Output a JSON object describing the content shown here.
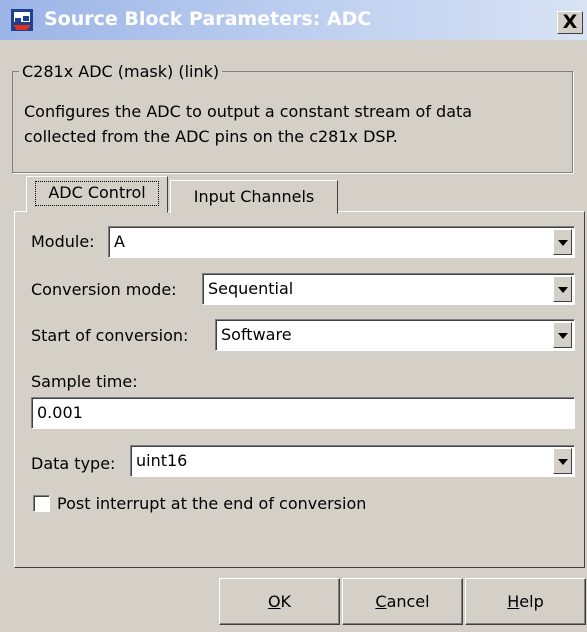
{
  "window": {
    "title": "Source Block Parameters: ADC",
    "close_label": "X"
  },
  "description": {
    "legend": "C281x ADC (mask) (link)",
    "text_line1": "Configures the ADC to output a constant stream of data",
    "text_line2": "collected from the ADC pins on the c281x DSP."
  },
  "tabs": [
    {
      "label": "ADC Control",
      "active": true
    },
    {
      "label": "Input Channels",
      "active": false
    }
  ],
  "form": {
    "module_label": "Module:",
    "module_value": "A",
    "conversion_mode_label": "Conversion mode:",
    "conversion_mode_value": "Sequential",
    "start_conversion_label": "Start of conversion:",
    "start_conversion_value": "Software",
    "sample_time_label": "Sample time:",
    "sample_time_value": "0.001",
    "data_type_label": "Data type:",
    "data_type_value": "uint16",
    "post_interrupt_label": "Post interrupt at the end of conversion",
    "post_interrupt_checked": false
  },
  "buttons": {
    "ok_mnemonic": "O",
    "ok_rest": "K",
    "cancel_mnemonic": "C",
    "cancel_rest": "ancel",
    "help_mnemonic": "H",
    "help_rest": "elp"
  },
  "colors": {
    "face": "#d4d0c8",
    "title_gradient_start": "#9bb4e6",
    "title_gradient_end": "#d8e2f4"
  },
  "icons": {
    "app": "simulink-block-icon",
    "dropdown": "chevron-down-icon"
  }
}
